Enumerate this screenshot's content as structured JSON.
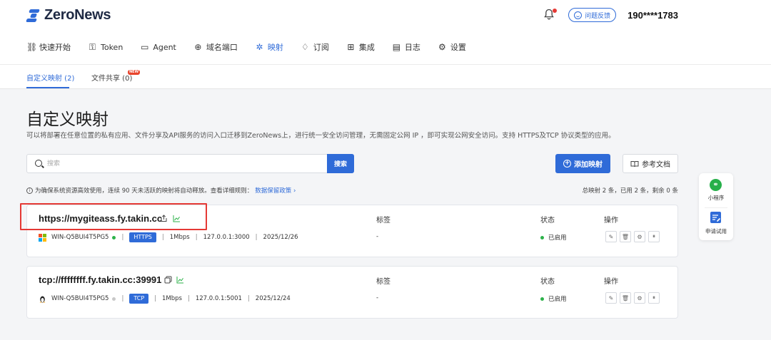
{
  "brand": {
    "name": "ZeroNews",
    "color": "#2f6bd8"
  },
  "header": {
    "feedback_label": "问题反馈",
    "user": "190****1783",
    "bell_icon": "bell-icon",
    "has_notification": true
  },
  "nav": [
    {
      "label": "快速开始",
      "icon": "link-icon",
      "glyph": "⛓"
    },
    {
      "label": "Token",
      "icon": "key-icon",
      "glyph": "⚿"
    },
    {
      "label": "Agent",
      "icon": "laptop-icon",
      "glyph": "▭"
    },
    {
      "label": "域名端口",
      "icon": "globe-icon",
      "glyph": "⊕"
    },
    {
      "label": "映射",
      "icon": "mapping-icon",
      "glyph": "✲",
      "active": true
    },
    {
      "label": "订阅",
      "icon": "diamond-icon",
      "glyph": "♢"
    },
    {
      "label": "集成",
      "icon": "grid-icon",
      "glyph": "⊞"
    },
    {
      "label": "日志",
      "icon": "document-icon",
      "glyph": "▤"
    },
    {
      "label": "设置",
      "icon": "gear-icon",
      "glyph": "⚙"
    }
  ],
  "subtabs": {
    "custom": "自定义映射 (2)",
    "fileshare": "文件共享 (0)",
    "new_badge": "NEW"
  },
  "page": {
    "title": "自定义映射",
    "description": "可以将部署在任意位置的私有应用、文件分享及API服务的访问入口迁移到ZeroNews上，进行统一安全访问管理，无需固定公网 IP ，即可实现公网安全访问。支持 HTTPS及TCP 协议类型的应用。"
  },
  "search": {
    "placeholder": "搜索",
    "button": "搜索"
  },
  "actions": {
    "add": "添加映射",
    "docs": "参考文档"
  },
  "notice": {
    "text": "为确保系统资源高效使用，连续 90 天未活跃的映射将自动释放。查看详细规则：",
    "link": "数据保留政策",
    "arrow": "›"
  },
  "totals": "总映射 2 条，已用 2 条，剩余 0 条",
  "columns": {
    "tags": "标签",
    "status": "状态",
    "ops": "操作"
  },
  "mappings": [
    {
      "domain": "https://mygiteass.fy.takin.cc",
      "os": "windows",
      "agent": "WIN-Q5BUI4T5PG5",
      "online": true,
      "online_color": "#2db24a",
      "protocol": "HTTPS",
      "bandwidth": "1Mbps",
      "target": "127.0.0.1:3000",
      "expires": "2025/12/26",
      "tags": "-",
      "status": "已启用"
    },
    {
      "domain": "tcp://ffffffff.fy.takin.cc:39991",
      "os": "linux",
      "agent": "WIN-Q5BUI4T5PG5",
      "online": false,
      "online_color": "#c8c8c8",
      "protocol": "TCP",
      "bandwidth": "1Mbps",
      "target": "127.0.0.1:5001",
      "expires": "2025/12/24",
      "tags": "-",
      "status": "已启用"
    }
  ],
  "sidebar": {
    "miniprogram": "小程序",
    "trial": "申请试用"
  }
}
